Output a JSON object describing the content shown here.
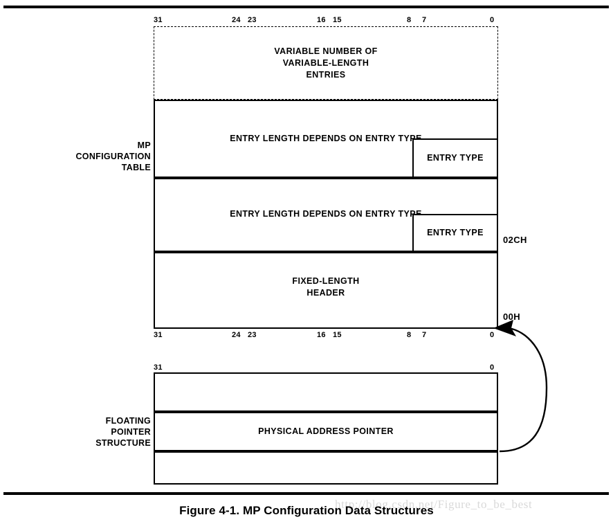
{
  "figure": {
    "caption": "Figure 4-1.  MP Configuration Data Structures",
    "watermark": "http://blog.csdn.net/Figure_to_be_best"
  },
  "bit_scale": {
    "labels": [
      "31",
      "24",
      "23",
      "16",
      "15",
      "8",
      "7",
      "0"
    ]
  },
  "mp_configuration_table": {
    "label": "MP\nCONFIGURATION\nTABLE",
    "variable_entries": {
      "text": "VARIABLE NUMBER OF\nVARIABLE-LENGTH\nENTRIES"
    },
    "entry_rows": [
      {
        "length_text": "ENTRY LENGTH DEPENDS ON ENTRY TYPE",
        "type_text": "ENTRY TYPE"
      },
      {
        "length_text": "ENTRY LENGTH DEPENDS ON ENTRY TYPE",
        "type_text": "ENTRY TYPE"
      }
    ],
    "header_row": {
      "text": "FIXED-LENGTH\nHEADER"
    },
    "address_labels": {
      "entries_offset": "02CH",
      "base_offset": "00H"
    }
  },
  "floating_pointer_structure": {
    "label": "FLOATING\nPOINTER\nSTRUCTURE",
    "rows": [
      {
        "text": ""
      },
      {
        "text": "PHYSICAL ADDRESS POINTER"
      },
      {
        "text": ""
      }
    ],
    "bit_scale": {
      "left": "31",
      "right": "0"
    }
  }
}
